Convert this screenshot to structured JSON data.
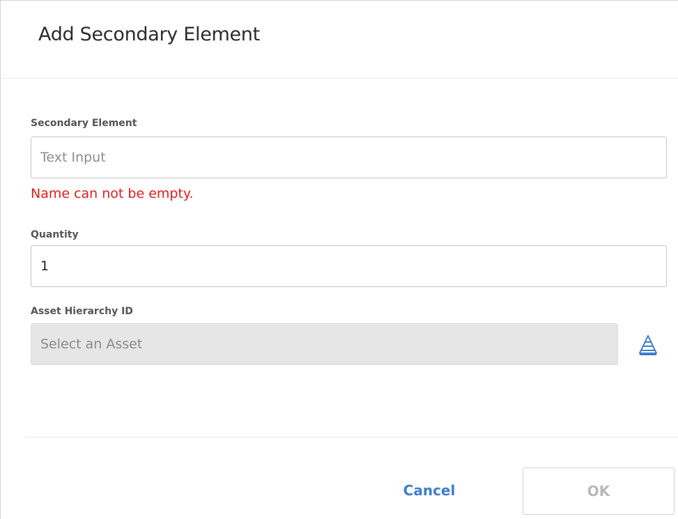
{
  "dialog": {
    "title": "Add Secondary Element"
  },
  "fields": {
    "secondary_element": {
      "label": "Secondary Element",
      "placeholder": "Text Input",
      "value": "",
      "error": "Name can not be empty."
    },
    "quantity": {
      "label": "Quantity",
      "value": "1"
    },
    "asset_hierarchy_id": {
      "label": "Asset Hierarchy ID",
      "placeholder": "Select an Asset",
      "icon": "hierarchy-icon"
    }
  },
  "footer": {
    "cancel_label": "Cancel",
    "ok_label": "OK"
  },
  "colors": {
    "error": "#e21b1b",
    "accent": "#3f7dcc",
    "disabled_text": "#b8b8b8"
  }
}
